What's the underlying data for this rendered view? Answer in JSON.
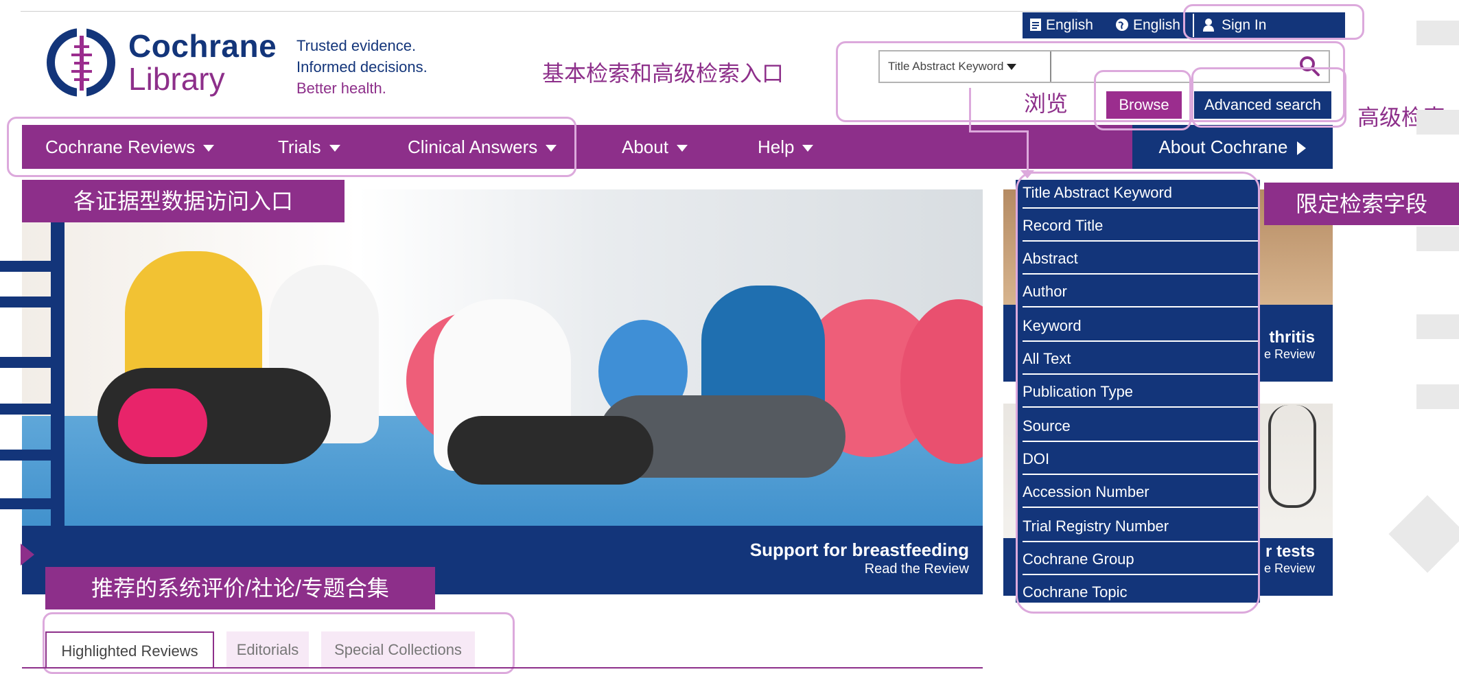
{
  "brand": {
    "name_line1": "Cochrane",
    "name_line2": "Library",
    "tagline": [
      "Trusted evidence.",
      "Informed decisions.",
      "Better health."
    ]
  },
  "top_bar": {
    "lang1": "English",
    "lang2": "English",
    "sign_in": "Sign In"
  },
  "search": {
    "field_selected": "Title Abstract Keyword",
    "browse": "Browse",
    "advanced": "Advanced search"
  },
  "nav": {
    "items": [
      "Cochrane Reviews",
      "Trials",
      "Clinical Answers",
      "About",
      "Help"
    ],
    "about_cochrane": "About Cochrane"
  },
  "hero": {
    "title": "Support for breastfeeding",
    "subtitle": "Read the Review"
  },
  "thumbs": [
    {
      "title": "thritis",
      "subtitle": "e Review"
    },
    {
      "title": "r tests",
      "subtitle": "e Review"
    }
  ],
  "search_fields": [
    "Title Abstract Keyword",
    "Record Title",
    "Abstract",
    "Author",
    "Keyword",
    "All Text",
    "Publication Type",
    "Source",
    "DOI",
    "Accession Number",
    "Trial Registry Number",
    "Cochrane Group",
    "Cochrane Topic"
  ],
  "tabs": [
    "Highlighted Reviews",
    "Editorials",
    "Special Collections"
  ],
  "annotations": {
    "search_entry": "基本检索和高级检索入口",
    "browse": "浏览",
    "advanced": "高级检索",
    "evidence_types": "各证据型数据访问入口",
    "limit_fields": "限定检索字段",
    "recommended": "推荐的系统评价/社论/专题合集"
  },
  "colors": {
    "navy": "#13357a",
    "purple": "#8d2f8a",
    "annotation_outline": "#dca9dc"
  }
}
